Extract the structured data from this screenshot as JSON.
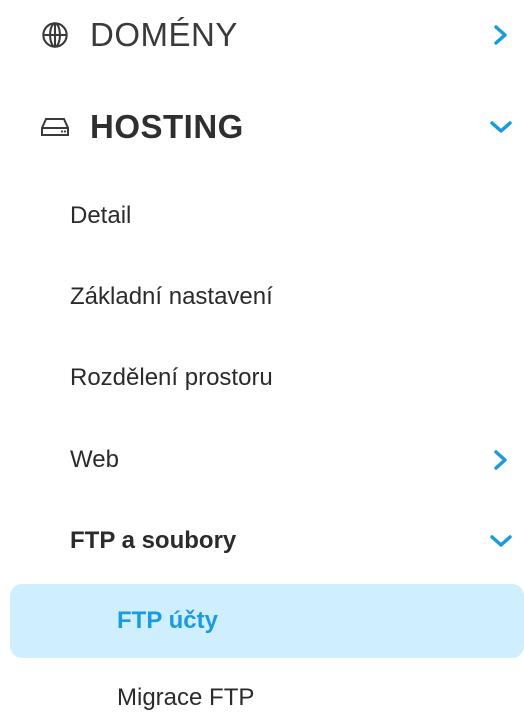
{
  "nav": {
    "sections": [
      {
        "label": "DOMÉNY",
        "icon": "globe-icon",
        "state": "collapsed"
      },
      {
        "label": "HOSTING",
        "icon": "hard-drive-icon",
        "state": "expanded"
      }
    ],
    "hosting_items": [
      {
        "label": "Detail"
      },
      {
        "label": "Základní nastavení"
      },
      {
        "label": "Rozdělení prostoru"
      },
      {
        "label": "Web",
        "state": "collapsed"
      },
      {
        "label": "FTP a soubory",
        "state": "expanded"
      }
    ],
    "ftp_items": [
      {
        "label": "FTP účty",
        "active": true
      },
      {
        "label": "Migrace FTP"
      }
    ]
  },
  "colors": {
    "accent": "#1a9be0",
    "active_bg": "#cfeefe",
    "text": "#2b2b2b"
  }
}
